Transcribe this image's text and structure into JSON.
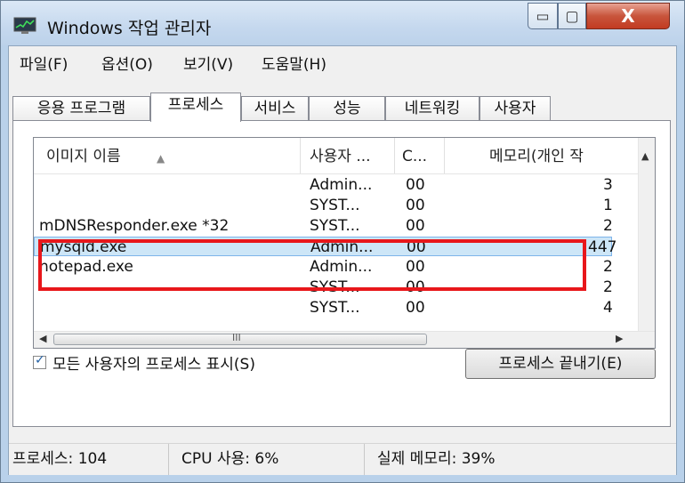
{
  "window": {
    "title": "Windows 작업 관리자",
    "icon": "task-manager-icon",
    "controls": {
      "minimize": "▭",
      "maximize": "▢",
      "close": "X"
    }
  },
  "menu": {
    "items": [
      "파일(F)",
      "옵션(O)",
      "보기(V)",
      "도움말(H)"
    ]
  },
  "tabs": [
    {
      "label": "응용 프로그램",
      "active": false
    },
    {
      "label": "프로세스",
      "active": true
    },
    {
      "label": "서비스",
      "active": false
    },
    {
      "label": "성능",
      "active": false
    },
    {
      "label": "네트워킹",
      "active": false
    },
    {
      "label": "사용자",
      "active": false
    }
  ],
  "processes": {
    "columns": [
      "이미지 이름",
      "사용자 ...",
      "C...",
      "메모리(개인 작"
    ],
    "rows": [
      {
        "name": "",
        "user": "Admin...",
        "cpu": "00",
        "mem": "3"
      },
      {
        "name": "",
        "user": "SYST...",
        "cpu": "00",
        "mem": "1"
      },
      {
        "name": "mDNSResponder.exe *32",
        "user": "SYST...",
        "cpu": "00",
        "mem": "2"
      },
      {
        "name": "mysqld.exe",
        "user": "Admin...",
        "cpu": "00",
        "mem": "447",
        "selected": true
      },
      {
        "name": "notepad.exe",
        "user": "Admin...",
        "cpu": "00",
        "mem": "2"
      },
      {
        "name": "",
        "user": "SYST...",
        "cpu": "00",
        "mem": "2"
      },
      {
        "name": "",
        "user": "SYST...",
        "cpu": "00",
        "mem": "4"
      }
    ],
    "scroll_grip": "III"
  },
  "show_all_users": {
    "label": "모든 사용자의 프로세스 표시(S)",
    "checked": true
  },
  "end_process_label": "프로세스 끝내기(E)",
  "status": {
    "processes": "프로세스: 104",
    "cpu": "CPU 사용: 6%",
    "memory": "실제 메모리: 39%"
  },
  "colors": {
    "highlight_box": "#e8171b",
    "selection": "#cde6f7"
  }
}
